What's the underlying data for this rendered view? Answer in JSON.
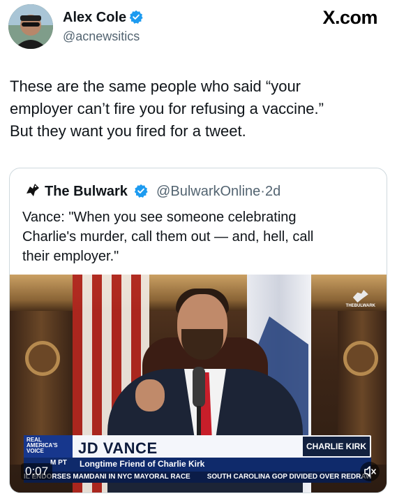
{
  "author": {
    "display_name": "Alex Cole",
    "handle": "@acnewsitics"
  },
  "site": "X.com",
  "tweet": {
    "text_lines": [
      "These are the same people who said “your",
      "employer can’t fire you for refusing a vaccine.”",
      "But they want you fired for a tweet."
    ]
  },
  "quote": {
    "name": "The Bulwark",
    "handle": "@BulwarkOnline",
    "age": "2d",
    "separator": "·",
    "text_lines": [
      "Vance: \"When you see someone celebrating",
      "Charlie's murder, call them out — and, hell, call",
      "their employer.\""
    ]
  },
  "video": {
    "time": "0:07",
    "watermark": "THEBULWARK",
    "network_logo": [
      "REAL",
      "AMERICA'S",
      "VOICE"
    ],
    "lower_third_name": "JD VANCE",
    "lower_third_subtitle": "Longtime Friend of Charlie Kirk",
    "tag": "M PT",
    "show_name": "CHARLIE KIRK",
    "ticker": [
      "IL ENDORSES MAMDANI IN NYC MAYORAL RACE",
      "SOUTH CAROLINA GOP DIVIDED OVER REDRAWING CONGF"
    ]
  },
  "icons": {
    "verified": "verified-badge-icon",
    "mute": "speaker-mute-icon"
  },
  "colors": {
    "verified_blue": "#1d9bf0",
    "handle_gray": "#536471",
    "border": "#cfd9de"
  }
}
